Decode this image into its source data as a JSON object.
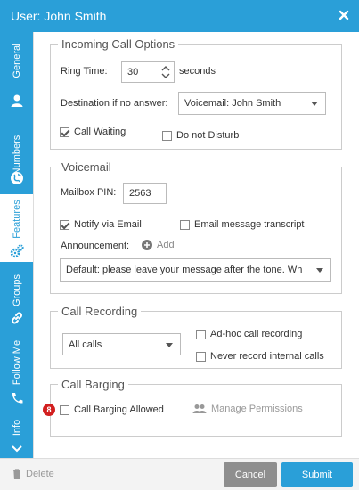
{
  "window": {
    "title": "User: John Smith",
    "close_icon": "close-icon"
  },
  "sidebar": {
    "tabs": [
      {
        "label": "General",
        "icon": "user-icon"
      },
      {
        "label": "Numbers",
        "icon": "globe-icon"
      },
      {
        "label": "Features",
        "icon": "gears-icon"
      },
      {
        "label": "Groups",
        "icon": "link-icon"
      },
      {
        "label": "Follow Me",
        "icon": "phone-icon"
      },
      {
        "label": "Info",
        "icon": "chevron-down-icon"
      }
    ]
  },
  "incoming": {
    "legend": "Incoming Call Options",
    "ring_time_label": "Ring Time:",
    "ring_time_value": "30",
    "ring_time_unit": "seconds",
    "destination_label": "Destination if no answer:",
    "destination_value": "Voicemail: John Smith",
    "call_waiting_label": "Call Waiting",
    "call_waiting_checked": true,
    "dnd_label": "Do not Disturb",
    "dnd_checked": false
  },
  "voicemail": {
    "legend": "Voicemail",
    "pin_label": "Mailbox PIN:",
    "pin_value": "2563",
    "notify_email_label": "Notify via Email",
    "notify_email_checked": true,
    "transcript_label": "Email message transcript",
    "transcript_checked": false,
    "announcement_label": "Announcement:",
    "add_label": "Add",
    "announcement_value": "Default: please leave your message after the tone. Wh"
  },
  "recording": {
    "legend": "Call Recording",
    "mode_value": "All calls",
    "adhoc_label": "Ad-hoc call recording",
    "never_internal_label": "Never record internal calls"
  },
  "barging": {
    "legend": "Call Barging",
    "badge": "8",
    "allowed_label": "Call Barging Allowed",
    "manage_label": "Manage Permissions"
  },
  "footer": {
    "delete_label": "Delete",
    "cancel_label": "Cancel",
    "submit_label": "Submit"
  },
  "colors": {
    "accent": "#2a9fd8",
    "cancel": "#8e8e8e",
    "badge": "#d21f1f"
  }
}
